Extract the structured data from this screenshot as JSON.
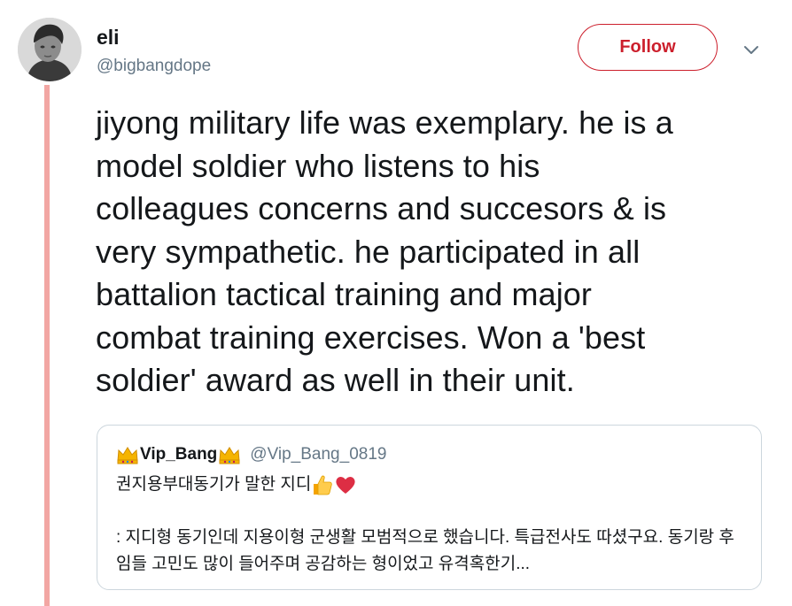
{
  "author": {
    "display_name": "eli",
    "handle": "@bigbangdope",
    "avatar": "profile-photo"
  },
  "actions": {
    "follow_label": "Follow",
    "menu_icon": "chevron-down-icon"
  },
  "tweet": {
    "text": "jiyong military life was exemplary. he is a\nmodel soldier who listens to his\ncolleagues concerns and succesors & is\nvery sympathetic. he participated in all\nbattalion tactical training and major\ncombat training exercises. Won a 'best\nsoldier' award as well in their unit."
  },
  "quoted_tweet": {
    "display_name": "Vip_Bang",
    "name_decoration": "crown-emoji",
    "handle": "@Vip_Bang_0819",
    "first_line": "권지용부대동기가 말한 지디",
    "first_line_emojis": [
      "thumbs-up-emoji",
      "red-heart-emoji"
    ],
    "body": ": 지디형 동기인데 지용이형 군생활 모범적으로 했습니다. 특급전사도 따셨구요. 동기랑 후임들 고민도 많이 들어주며 공감하는 형이었고 유격혹한기..."
  },
  "colors": {
    "accent": "#cc1f2c",
    "thread_line": "#f2a6a3",
    "text_primary": "#14171a",
    "text_secondary": "#657786",
    "border": "#ccd6dd"
  }
}
